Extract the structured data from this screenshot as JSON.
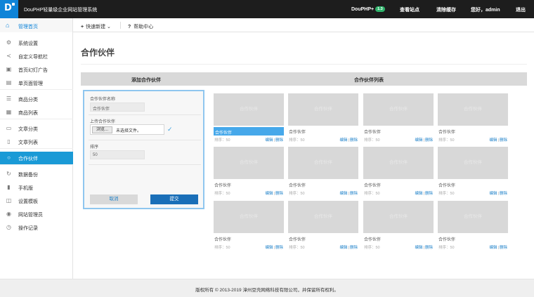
{
  "header": {
    "title": "DouPHP轻量级企业网站管理系统",
    "brand": "DouPHP+",
    "version": "1.3",
    "view_site": "查看站点",
    "clear_cache": "清除缓存",
    "greeting": "您好，admin",
    "logout": "退出"
  },
  "subbar": {
    "home": "管理首页",
    "quick_new": "快速新建",
    "help": "帮助中心"
  },
  "sidebar": {
    "items": [
      {
        "label": "系统设置",
        "icon": "gear-icon"
      },
      {
        "label": "自定义导航栏",
        "icon": "share-icon"
      },
      {
        "label": "首页幻灯广告",
        "icon": "image-icon"
      },
      {
        "label": "单页面管理",
        "icon": "page-icon"
      },
      {
        "label": "商品分类",
        "icon": "list-icon"
      },
      {
        "label": "商品列表",
        "icon": "grid-icon"
      },
      {
        "label": "文章分类",
        "icon": "folder-icon"
      },
      {
        "label": "文章列表",
        "icon": "document-icon"
      },
      {
        "label": "合作伙伴",
        "icon": "circle-icon"
      },
      {
        "label": "数据备份",
        "icon": "refresh-icon"
      },
      {
        "label": "手机版",
        "icon": "mobile-icon"
      },
      {
        "label": "设置模板",
        "icon": "template-icon"
      },
      {
        "label": "网站管理员",
        "icon": "user-icon"
      },
      {
        "label": "操作记录",
        "icon": "clock-icon"
      }
    ],
    "active_index": 8
  },
  "main": {
    "page_title": "合作伙伴",
    "add_header": "添加合作伙伴",
    "list_header": "合作伙伴列表"
  },
  "form": {
    "name_label": "合作伙伴名称",
    "name_value": "合作伙伴",
    "upload_label": "上传合作伙伴",
    "browse": "浏览...",
    "no_file": "未选择文件。",
    "sort_label": "排序",
    "sort_value": "50",
    "cancel": "取消",
    "submit": "提交"
  },
  "cards": {
    "placeholder": "合作伙伴",
    "name": "合作伙伴",
    "sort": "排序：50",
    "edit": "编辑",
    "delete": "删除",
    "selected_index": 0
  },
  "footer": {
    "copyright": "版权所有 © 2013-2019 漳州豆壳网络科技有限公司，并保留所有权利。"
  },
  "colors": {
    "accent": "#1a9ad6",
    "topbar": "#1d1d1d",
    "logo": "#0f84d8",
    "submit": "#1a6fb8"
  }
}
